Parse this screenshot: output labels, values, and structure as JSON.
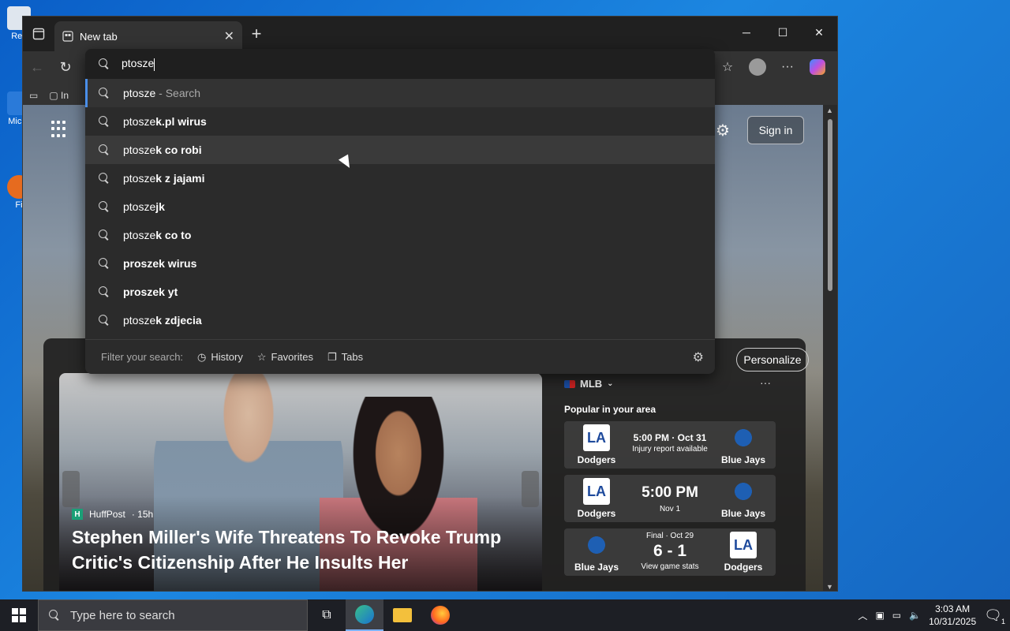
{
  "desktop": {
    "icons": [
      "Rec",
      "Mic E",
      "Fi"
    ]
  },
  "browser": {
    "tab_title": "New tab",
    "favorites_bar": {
      "item": "In"
    },
    "omnibox": {
      "query": "ptosze",
      "suggestions": [
        {
          "prefix": "ptosze",
          "suffix": " - Search",
          "bold": ""
        },
        {
          "prefix": "ptosze",
          "suffix": "",
          "bold": "k.pl wirus"
        },
        {
          "prefix": "ptosze",
          "suffix": "",
          "bold": "k co robi"
        },
        {
          "prefix": "ptosze",
          "suffix": "",
          "bold": "k z jajami"
        },
        {
          "prefix": "ptosze",
          "suffix": "",
          "bold": "jk"
        },
        {
          "prefix": "ptosze",
          "suffix": "",
          "bold": "k co to"
        },
        {
          "prefix": "",
          "suffix": "",
          "bold": "proszek wirus"
        },
        {
          "prefix": "",
          "suffix": "",
          "bold": "proszek yt"
        },
        {
          "prefix": "ptosze",
          "suffix": "",
          "bold": "k zdjecia"
        }
      ],
      "filter_label": "Filter your search:",
      "filters": [
        "History",
        "Favorites",
        "Tabs"
      ]
    }
  },
  "newtab": {
    "sign_in": "Sign in",
    "personalize": "Personalize",
    "hero": {
      "source": "HuffPost",
      "age": "· 15h",
      "source_logo": "H",
      "headline": "Stephen Miller's Wife Threatens To Revoke Trump Critic's Citizenship After He Insults Her"
    },
    "mlb": {
      "title": "MLB",
      "subtitle": "Popular in your area",
      "more": "···",
      "games": [
        {
          "left": "Dodgers",
          "right": "Blue Jays",
          "line1": "5:00 PM · Oct 31",
          "line2": "Injury report available",
          "style": "upcoming_small"
        },
        {
          "left": "Dodgers",
          "right": "Blue Jays",
          "line1": "5:00 PM",
          "line2": "Nov 1",
          "style": "upcoming_big"
        },
        {
          "left": "Blue Jays",
          "right": "Dodgers",
          "line1": "Final · Oct 29",
          "score": "6 - 1",
          "line2": "View game stats",
          "style": "final"
        }
      ]
    }
  },
  "taskbar": {
    "search_placeholder": "Type here to search",
    "time": "3:03 AM",
    "date": "10/31/2025",
    "notifications": "1"
  },
  "colors": {
    "desktop": "#1c86e0",
    "accent": "#4a8ee8",
    "window_bg": "#202020"
  }
}
